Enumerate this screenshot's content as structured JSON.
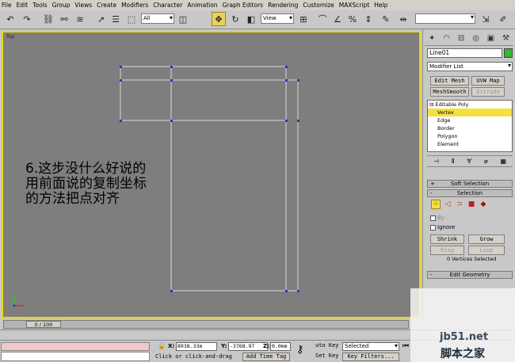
{
  "menu": [
    "File",
    "Edit",
    "Tools",
    "Group",
    "Views",
    "Create",
    "Modifiers",
    "Character",
    "Animation",
    "Graph Editors",
    "Rendering",
    "Customize",
    "MAXScript",
    "Help"
  ],
  "toolbar": {
    "selection_filter": "All",
    "ref_coord": "View"
  },
  "viewport": {
    "label": "Top",
    "annotation_lines": [
      "6.这步没什么好说的",
      "用前面说的复制坐标",
      "的方法把点对齐"
    ]
  },
  "command_panel": {
    "object_name": "Line01",
    "object_color": "#2fba2f",
    "modifier_list": "Modifier List",
    "buttons": {
      "edit_mesh": "Edit Mesh",
      "uvw_map": "UVW Map",
      "meshsmooth": "MeshSmooth",
      "extrude": "Extrude"
    },
    "stack": {
      "top": "Editable Poly",
      "items": [
        "Vertex",
        "Edge",
        "Border",
        "Polygon",
        "Element"
      ],
      "selected": "Vertex"
    },
    "rollouts": {
      "soft_selection": "Soft Selection",
      "selection": "Selection",
      "edit_geometry": "Edit Geometry"
    },
    "by_label": "By",
    "ignore_label": "Ignore",
    "shrink": "Shrink",
    "grow": "Grow",
    "ring": "Ring",
    "loop": "Loop",
    "vertices_selected": "0 Vertices Selected"
  },
  "time": {
    "slider": "0 / 100"
  },
  "status": {
    "x_label": "X:",
    "x_value": "8938.33m",
    "y_label": "Y:",
    "y_value": "-3768.97",
    "z_label": "Z:",
    "z_value": "0.0mm",
    "prompt": "Click or click-and-drag",
    "add_time_tag": "Add Time Tag",
    "auto_key": "uto Key",
    "set_key": "Set Key",
    "selected": "Selected",
    "key_filters": "Key Filters..."
  },
  "watermark": {
    "line1": "jb51.net",
    "line2": "脚本之家"
  }
}
